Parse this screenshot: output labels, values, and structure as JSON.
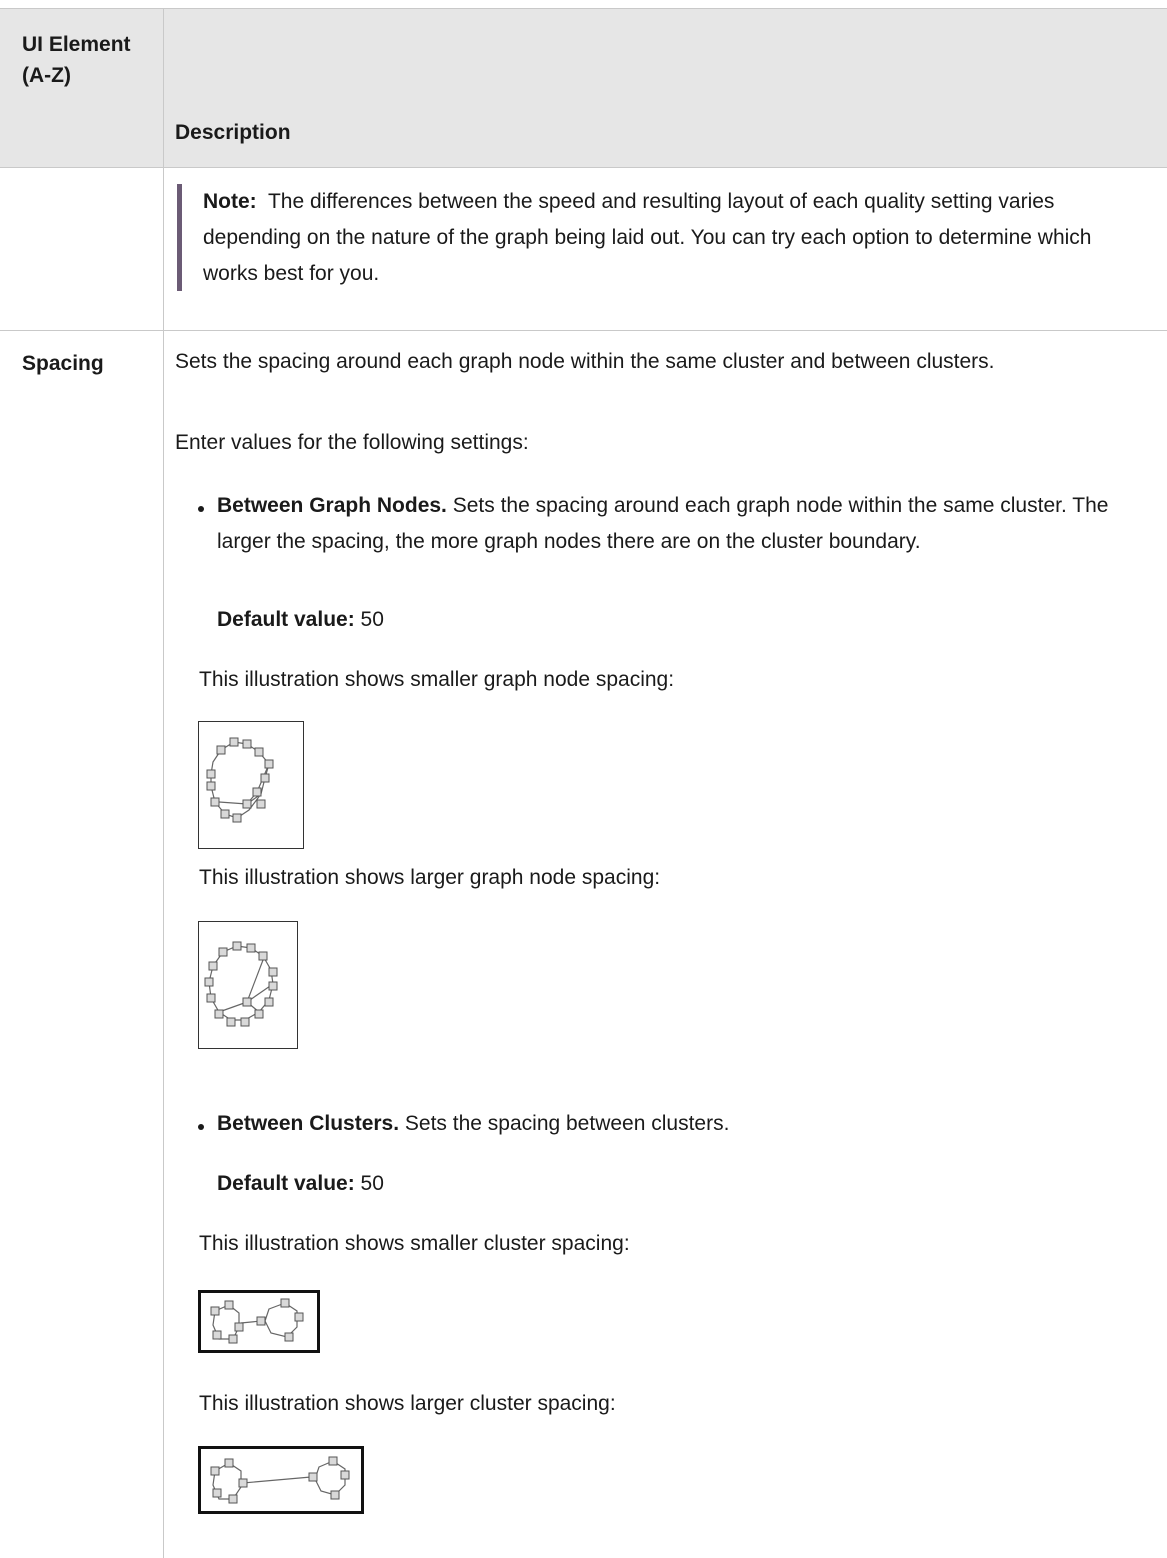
{
  "table": {
    "header": {
      "col1": "UI Element (A-Z)",
      "col2": "Description"
    },
    "note": {
      "label": "Note:",
      "text": "The differences between the speed and resulting layout of each quality setting varies depending on the nature of the graph being laid out. You can try each option to determine which works best for you."
    },
    "spacing_row": {
      "label": "Spacing",
      "intro": "Sets the spacing around each graph node within the same cluster and between clusters.",
      "enter_values": "Enter values for the following settings:",
      "between_nodes": {
        "title": "Between Graph Nodes.",
        "text": "Sets the spacing around each graph node within the same cluster. The larger the spacing, the more graph nodes there are on the cluster boundary.",
        "default_label": "Default value:",
        "default_value": "50",
        "smaller_caption": "This illustration shows smaller graph node spacing:",
        "larger_caption": "This illustration shows larger graph node spacing:"
      },
      "between_clusters": {
        "title": "Between Clusters.",
        "text": "Sets the spacing between clusters.",
        "default_label": "Default value:",
        "default_value": "50",
        "smaller_caption": "This illustration shows smaller cluster spacing:",
        "larger_caption": "This illustration shows larger cluster spacing:"
      }
    }
  }
}
